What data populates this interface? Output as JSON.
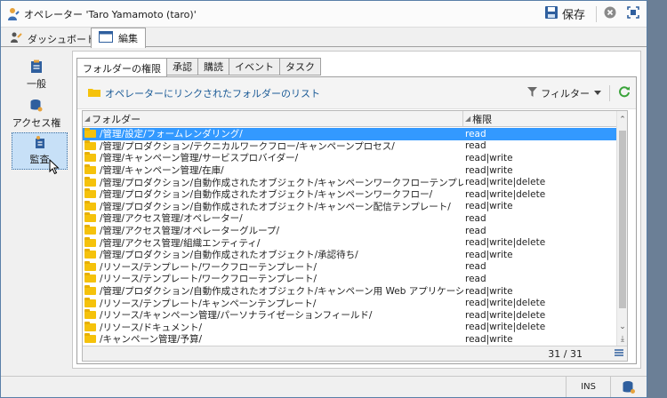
{
  "window": {
    "title": "オペレーター 'Taro Yamamoto (taro)'",
    "save_label": "保存"
  },
  "main_tabs": [
    {
      "label": "ダッシュボード"
    },
    {
      "label": "編集"
    }
  ],
  "left_nav": [
    {
      "label": "一般"
    },
    {
      "label": "アクセス権"
    },
    {
      "label": "監査"
    }
  ],
  "sub_tabs": [
    {
      "label": "フォルダーの権限"
    },
    {
      "label": "承認"
    },
    {
      "label": "購読"
    },
    {
      "label": "イベント"
    },
    {
      "label": "タスク"
    }
  ],
  "panel": {
    "list_title": "オペレーターにリンクされたフォルダーのリスト",
    "filter_label": "フィルター"
  },
  "grid": {
    "col_folder": "フォルダー",
    "col_rights": "権限",
    "rows": [
      {
        "folder": "/管理/設定/フォームレンダリング/",
        "rights": "read"
      },
      {
        "folder": "/管理/プロダクション/テクニカルワークフロー/キャンペーンプロセス/",
        "rights": "read"
      },
      {
        "folder": "/管理/キャンペーン管理/サービスプロバイダー/",
        "rights": "read|write"
      },
      {
        "folder": "/管理/キャンペーン管理/在庫/",
        "rights": "read|write"
      },
      {
        "folder": "/管理/プロダクション/自動作成されたオブジェクト/キャンペーンワークフローテンプレート/",
        "rights": "read|write|delete"
      },
      {
        "folder": "/管理/プロダクション/自動作成されたオブジェクト/キャンペーンワークフロー/",
        "rights": "read|write|delete"
      },
      {
        "folder": "/管理/プロダクション/自動作成されたオブジェクト/キャンペーン配信テンプレート/",
        "rights": "read|write"
      },
      {
        "folder": "/管理/アクセス管理/オペレーター/",
        "rights": "read"
      },
      {
        "folder": "/管理/アクセス管理/オペレーターグループ/",
        "rights": "read"
      },
      {
        "folder": "/管理/アクセス管理/組織エンティティ/",
        "rights": "read|write|delete"
      },
      {
        "folder": "/管理/プロダクション/自動作成されたオブジェクト/承認待ち/",
        "rights": "read|write"
      },
      {
        "folder": "/リソース/テンプレート/ワークフローテンプレート/",
        "rights": "read"
      },
      {
        "folder": "/リソース/テンプレート/ワークフローテンプレート/",
        "rights": "read"
      },
      {
        "folder": "/管理/プロダクション/自動作成されたオブジェクト/キャンペーン用 Web アプリケーションテン...",
        "rights": "read|write"
      },
      {
        "folder": "/リソース/テンプレート/キャンペーンテンプレート/",
        "rights": "read|write|delete"
      },
      {
        "folder": "/リソース/キャンペーン管理/パーソナライゼーションフィールド/",
        "rights": "read|write|delete"
      },
      {
        "folder": "/リソース/ドキュメント/",
        "rights": "read|write|delete"
      },
      {
        "folder": "/キャンペーン管理/予算/",
        "rights": "read|write"
      }
    ],
    "count": "31 / 31"
  },
  "statusbar": {
    "mode": "INS"
  },
  "colors": {
    "selected_row": "#3399ff",
    "folder": "#f5c20b",
    "link_text": "#1a5a96",
    "nav_selected": "#c7e0f7"
  }
}
